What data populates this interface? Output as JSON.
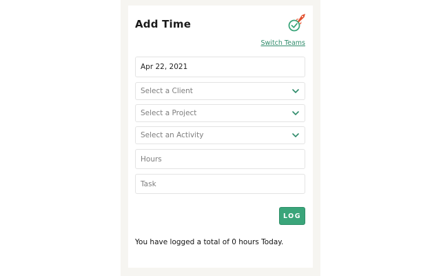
{
  "header": {
    "title": "Add Time",
    "switch_teams_label": "Switch Teams",
    "logo_icon": "rocket-checkmark-icon"
  },
  "form": {
    "date_value": "Apr 22, 2021",
    "client_placeholder": "Select a Client",
    "project_placeholder": "Select a Project",
    "activity_placeholder": "Select an Activity",
    "hours_placeholder": "Hours",
    "task_placeholder": "Task",
    "log_button_label": "LOG"
  },
  "summary": {
    "text": "You have logged a total of 0 hours Today."
  },
  "colors": {
    "accent": "#3aa57a",
    "chevron": "#2e8b6a",
    "rocket": "#e2502e",
    "panel_background": "#f6f5f1"
  }
}
